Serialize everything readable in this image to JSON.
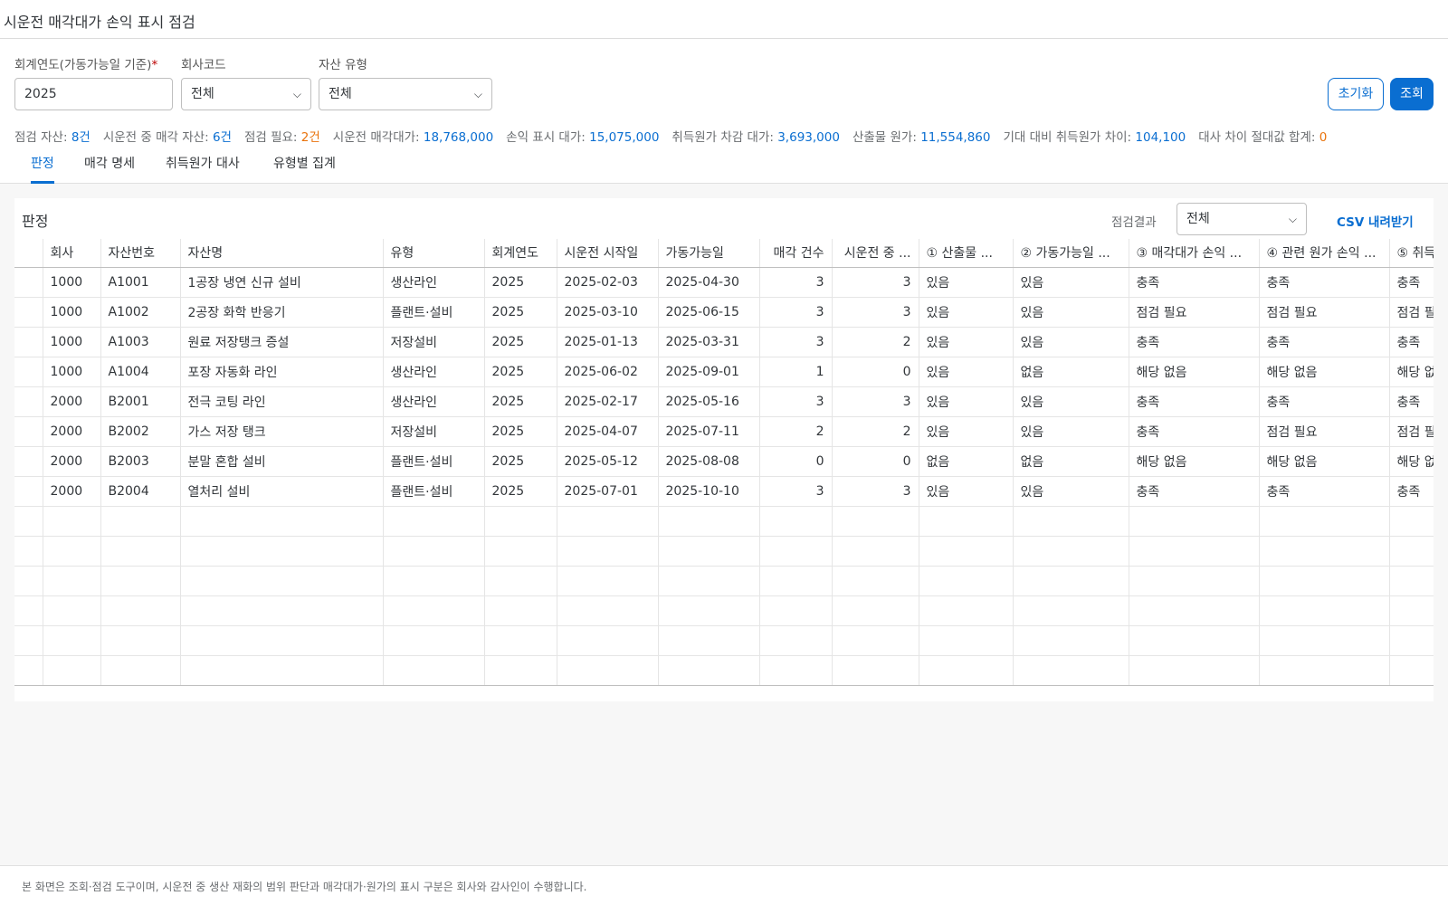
{
  "app": {
    "title": "시운전 매각대가 손익 표시 점검"
  },
  "filters": {
    "fiscal_year": {
      "label": "회계연도(가동가능일 기준)",
      "required_mark": "*",
      "value": "2025"
    },
    "company": {
      "label": "회사코드",
      "value": "전체"
    },
    "asset_type": {
      "label": "자산 유형",
      "value": "전체"
    },
    "reset_label": "초기화",
    "search_label": "조회"
  },
  "stats": [
    {
      "label": "점검 자산:",
      "value": "8건",
      "tone": "info"
    },
    {
      "label": "시운전 중 매각 자산:",
      "value": "6건",
      "tone": "info"
    },
    {
      "label": "점검 필요:",
      "value": "2건",
      "tone": "warn"
    },
    {
      "label": "시운전 매각대가:",
      "value": "18,768,000",
      "tone": "info"
    },
    {
      "label": "손익 표시 대가:",
      "value": "15,075,000",
      "tone": "info"
    },
    {
      "label": "취득원가 차감 대가:",
      "value": "3,693,000",
      "tone": "info"
    },
    {
      "label": "산출물 원가:",
      "value": "11,554,860",
      "tone": "info"
    },
    {
      "label": "기대 대비 취득원가 차이:",
      "value": "104,100",
      "tone": "info"
    },
    {
      "label": "대사 차이 절대값 합계:",
      "value": "0",
      "tone": "warn"
    }
  ],
  "tabs": [
    {
      "label": "판정",
      "active": true
    },
    {
      "label": "매각 명세",
      "active": false
    },
    {
      "label": "취득원가 대사",
      "active": false
    },
    {
      "label": "유형별 집계",
      "active": false
    }
  ],
  "panel": {
    "title": "판정",
    "result_filter_label": "점검결과",
    "result_filter_value": "전체",
    "csv_label": "CSV 내려받기"
  },
  "table": {
    "columns": [
      "",
      "회사",
      "자산번호",
      "자산명",
      "유형",
      "회계연도",
      "시운전 시작일",
      "가동가능일",
      "매각 건수",
      "시운전 중 ...",
      "① 산출물 ...",
      "② 가동가능일 ...",
      "③ 매각대가 손익 ...",
      "④ 관련 원가 손익 ...",
      "⑤ 취득"
    ],
    "rows": [
      [
        "",
        "1000",
        "A1001",
        "1공장 냉연 신규 설비",
        "생산라인",
        "2025",
        "2025-02-03",
        "2025-04-30",
        "3",
        "3",
        "있음",
        "있음",
        "충족",
        "충족",
        "충족"
      ],
      [
        "",
        "1000",
        "A1002",
        "2공장 화학 반응기",
        "플랜트·설비",
        "2025",
        "2025-03-10",
        "2025-06-15",
        "3",
        "3",
        "있음",
        "있음",
        "점검 필요",
        "점검 필요",
        "점검 필요"
      ],
      [
        "",
        "1000",
        "A1003",
        "원료 저장탱크 증설",
        "저장설비",
        "2025",
        "2025-01-13",
        "2025-03-31",
        "3",
        "2",
        "있음",
        "있음",
        "충족",
        "충족",
        "충족"
      ],
      [
        "",
        "1000",
        "A1004",
        "포장 자동화 라인",
        "생산라인",
        "2025",
        "2025-06-02",
        "2025-09-01",
        "1",
        "0",
        "있음",
        "없음",
        "해당 없음",
        "해당 없음",
        "해당 없음"
      ],
      [
        "",
        "2000",
        "B2001",
        "전극 코팅 라인",
        "생산라인",
        "2025",
        "2025-02-17",
        "2025-05-16",
        "3",
        "3",
        "있음",
        "있음",
        "충족",
        "충족",
        "충족"
      ],
      [
        "",
        "2000",
        "B2002",
        "가스 저장 탱크",
        "저장설비",
        "2025",
        "2025-04-07",
        "2025-07-11",
        "2",
        "2",
        "있음",
        "있음",
        "충족",
        "점검 필요",
        "점검 필요"
      ],
      [
        "",
        "2000",
        "B2003",
        "분말 혼합 설비",
        "플랜트·설비",
        "2025",
        "2025-05-12",
        "2025-08-08",
        "0",
        "0",
        "없음",
        "없음",
        "해당 없음",
        "해당 없음",
        "해당 없음"
      ],
      [
        "",
        "2000",
        "B2004",
        "열처리 설비",
        "플랜트·설비",
        "2025",
        "2025-07-01",
        "2025-10-10",
        "3",
        "3",
        "있음",
        "있음",
        "충족",
        "충족",
        "충족"
      ]
    ],
    "empty_rows": 6
  },
  "footer": {
    "note": "본 화면은 조회·점검 도구이며, 시운전 중 생산 재화의 범위 판단과 매각대가·원가의 표시 구분은 회사와 감사인이 수행합니다."
  },
  "colors": {
    "accent": "#0a6ed1",
    "positive": "#256f3a",
    "critical": "#e9730c"
  }
}
